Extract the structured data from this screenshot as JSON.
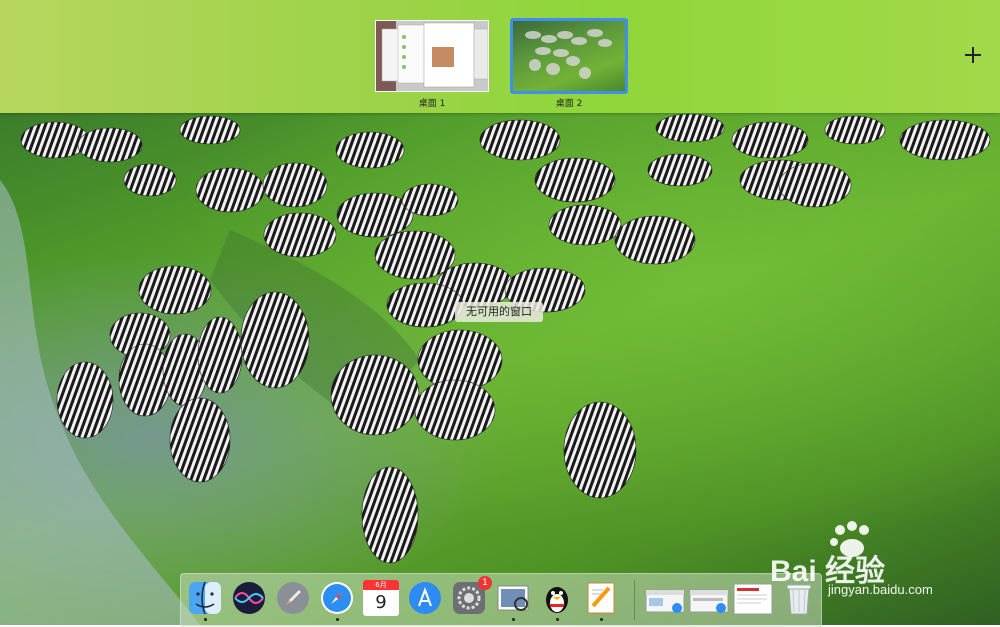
{
  "spaces": [
    {
      "label": "桌面 1",
      "active": false
    },
    {
      "label": "桌面 2",
      "active": true
    }
  ],
  "add_space_icon": "plus-icon",
  "tooltip": "无可用的窗口",
  "colors": {
    "active_space_border": "#3f8ff0",
    "bar_green": "#9ed34a",
    "badge_red": "#e33333"
  },
  "dock": {
    "apps": [
      {
        "name": "finder",
        "icon": "finder-icon",
        "running": true
      },
      {
        "name": "siri",
        "icon": "siri-icon",
        "running": false
      },
      {
        "name": "launchpad",
        "icon": "rocket-icon",
        "running": false
      },
      {
        "name": "safari",
        "icon": "compass-icon",
        "running": true
      },
      {
        "name": "calendar",
        "icon": "calendar-icon",
        "running": false,
        "month": "6月",
        "day": "9"
      },
      {
        "name": "app-store",
        "icon": "app-store-icon",
        "running": false
      },
      {
        "name": "system-preferences",
        "icon": "gear-icon",
        "running": false,
        "badge": "1"
      },
      {
        "name": "preview",
        "icon": "preview-icon",
        "running": true
      },
      {
        "name": "qq",
        "icon": "penguin-icon",
        "running": true
      },
      {
        "name": "pages",
        "icon": "pages-icon",
        "running": true
      }
    ],
    "minimized": [
      {
        "name": "minimized-window-1",
        "icon": "safari-window-icon"
      },
      {
        "name": "minimized-window-2",
        "icon": "safari-window-icon"
      },
      {
        "name": "minimized-window-3",
        "icon": "document-window-icon"
      }
    ],
    "trash": {
      "name": "trash",
      "icon": "trash-icon"
    }
  },
  "watermark": {
    "brand": "Bai 经验",
    "url": "jingyan.baidu.com"
  }
}
